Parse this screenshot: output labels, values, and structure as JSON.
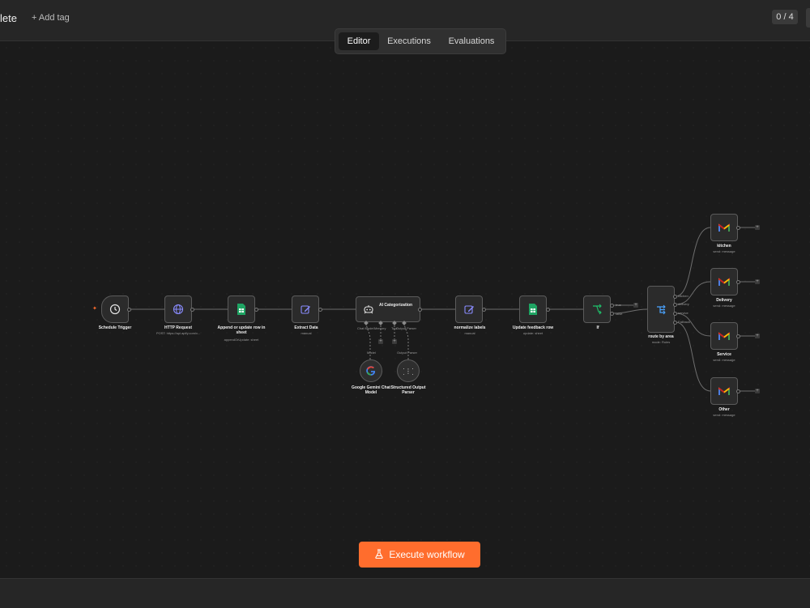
{
  "header": {
    "title": "lete",
    "add_tag": "+ Add tag",
    "counter": "0 / 4"
  },
  "tabs": [
    "Editor",
    "Executions",
    "Evaluations"
  ],
  "nodes": {
    "schedule": {
      "label": "Schedule Trigger",
      "sub": ""
    },
    "http": {
      "label": "HTTP Request",
      "sub": "POST: https://api.apify.com/v..."
    },
    "append": {
      "label": "Append or update row in sheet",
      "sub": "appendOrUpdate: sheet"
    },
    "extract": {
      "label": "Extract Data",
      "sub": "manual"
    },
    "ai": {
      "label": "AI Categorization",
      "sub": ""
    },
    "normalize": {
      "label": "normalize labels",
      "sub": "manual"
    },
    "feedback": {
      "label": "Update feedback row",
      "sub": "update: sheet"
    },
    "if": {
      "label": "If",
      "sub": ""
    },
    "route": {
      "label": "route by area",
      "sub": "mode: Rules"
    },
    "gemini": {
      "label": "Google Gemini Chat Model",
      "sub": ""
    },
    "parser": {
      "label": "Structured Output Parser",
      "sub": ""
    },
    "kitchen": {
      "label": "kitchen",
      "sub": "send: message"
    },
    "delivery": {
      "label": "Delivery",
      "sub": "send: message"
    },
    "service": {
      "label": "Service",
      "sub": "send: message"
    },
    "other": {
      "label": "Other",
      "sub": "send: message"
    }
  },
  "ports": {
    "chat_model": "Chat Model",
    "memory": "Memory",
    "tool": "Tool",
    "output_parser": "Output Parser",
    "model": "Model",
    "true": "true",
    "false": "false",
    "kitchen": "kitchen",
    "delivery": "delivery",
    "service": "service",
    "fallback": "Fallback"
  },
  "execute_button": "Execute workflow",
  "colors": {
    "accent": "#ff6d2d",
    "sheets": "#1fa463",
    "http": "#8a8cff",
    "edit": "#8a8cff",
    "if": "#1fbf6a",
    "router": "#4aa3ff"
  }
}
